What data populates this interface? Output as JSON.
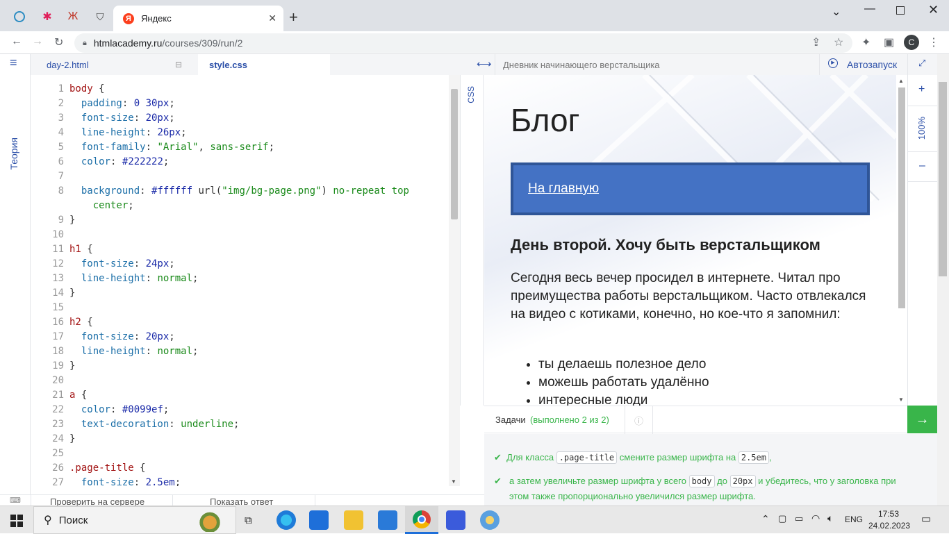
{
  "browser": {
    "active_tab_title": "Яндекс",
    "tab_close": "✕",
    "new_tab": "+",
    "url_host": "htmlacademy.ru",
    "url_path": "/courses/309/run/2",
    "profile_initial": "C"
  },
  "app": {
    "theory_label": "Теория",
    "file_tabs": [
      {
        "label": "day-2.html"
      },
      {
        "label": "style.css"
      }
    ],
    "css_label": "CSS",
    "preview_title": "Дневник начинающего верстальщика",
    "autorun_label": "Автозапуск",
    "zoom_level": "100%",
    "zoom_plus": "+",
    "zoom_minus": "–",
    "check_button": "Проверить на сервере",
    "answer_button": "Показать ответ"
  },
  "editor": {
    "line_numbers": [
      "1",
      "2",
      "3",
      "4",
      "5",
      "6",
      "7",
      "8",
      "",
      "9",
      "10",
      "11",
      "12",
      "13",
      "14",
      "15",
      "16",
      "17",
      "18",
      "19",
      "20",
      "21",
      "22",
      "23",
      "24",
      "25",
      "26",
      "27"
    ],
    "code_lines": [
      "body {",
      "  padding: 0 30px;",
      "  font-size: 20px;",
      "  line-height: 26px;",
      "  font-family: \"Arial\", sans-serif;",
      "  color: #222222;",
      "",
      "  background: #ffffff url(\"img/bg-page.png\") no-repeat top",
      "    center;",
      "}",
      "",
      "h1 {",
      "  font-size: 24px;",
      "  line-height: normal;",
      "}",
      "",
      "h2 {",
      "  font-size: 20px;",
      "  line-height: normal;",
      "}",
      "",
      "a {",
      "  color: #0099ef;",
      "  text-decoration: underline;",
      "}",
      "",
      ".page-title {",
      "  font-size: 2.5em;"
    ]
  },
  "preview": {
    "page_title": "Блог",
    "nav_link": "На главную",
    "post_heading": "День второй. Хочу быть верстальщиком",
    "post_text": "Сегодня весь вечер просидел в интернете. Читал про преимущества работы верстальщиком. Часто отвлекался на видео с котиками, конечно, но кое-что я запомнил:",
    "list": [
      "ты делаешь полезное дело",
      "можешь работать удалённо",
      "интересные люди"
    ]
  },
  "tasks": {
    "label": "Задачи",
    "progress": "(выполнено 2 из 2)",
    "items": [
      {
        "pre": "Для класса",
        "code1": ".page-title",
        "mid": "смените размер шрифта на",
        "code2": "2.5em",
        "post": ","
      },
      {
        "pre": "а затем увеличьте размер шрифта у всего",
        "code1": "body",
        "mid": "до",
        "code2": "20px",
        "post": "и убедитесь, что у заголовка при этом также пропорционально увеличился размер шрифта."
      }
    ]
  },
  "taskbar": {
    "search_placeholder": "Поиск",
    "language": "ENG",
    "time": "17:53",
    "date": "24.02.2023"
  },
  "colors": {
    "accent_green": "#39b54a",
    "nav_blue": "#4472c4",
    "nav_border": "#2f5597"
  }
}
